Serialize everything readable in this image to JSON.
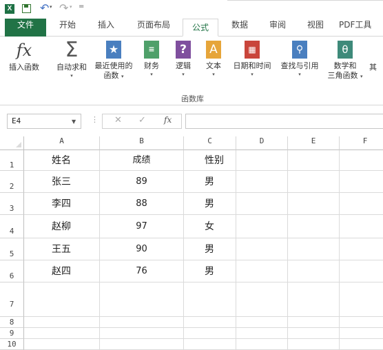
{
  "quick_access": {
    "app_logo_text": "X",
    "more_symbol": "="
  },
  "tabs": [
    {
      "label": "文件"
    },
    {
      "label": "开始"
    },
    {
      "label": "插入"
    },
    {
      "label": "页面布局"
    },
    {
      "label": "公式"
    },
    {
      "label": "数据"
    },
    {
      "label": "审阅"
    },
    {
      "label": "视图"
    },
    {
      "label": "PDF工具"
    }
  ],
  "ribbon": {
    "insert_function": "插入函数",
    "autosum": "自动求和",
    "recent_1": "最近使用的",
    "recent_2": "函数",
    "financial": "财务",
    "logical": "逻辑",
    "text": "文本",
    "datetime": "日期和时间",
    "lookup": "查找与引用",
    "math_1": "数学和",
    "math_2": "三角函数",
    "more_cut": "其",
    "group_label": "函数库",
    "fx_glyph": "fx",
    "sigma_glyph": "Σ",
    "logical_glyph": "?",
    "text_glyph": "A",
    "math_glyph": "θ"
  },
  "formula_bar": {
    "name_box": "E4",
    "fx_label": "fx",
    "formula": ""
  },
  "columns": [
    "A",
    "B",
    "C",
    "D",
    "E",
    "F"
  ],
  "rows": [
    {
      "num": "1",
      "a": "姓名",
      "b": "成绩",
      "c": "性别"
    },
    {
      "num": "2",
      "a": "张三",
      "b": "89",
      "c": "男"
    },
    {
      "num": "3",
      "a": "李四",
      "b": "88",
      "c": "男"
    },
    {
      "num": "4",
      "a": "赵柳",
      "b": "97",
      "c": "女"
    },
    {
      "num": "5",
      "a": "王五",
      "b": "90",
      "c": "男"
    },
    {
      "num": "6",
      "a": "赵四",
      "b": "76",
      "c": "男"
    },
    {
      "num": "7"
    },
    {
      "num": "8"
    },
    {
      "num": "9"
    },
    {
      "num": "10"
    }
  ],
  "colors": {
    "accent": "#217346",
    "ribbon_blue": "#4a7fbf",
    "ribbon_green": "#4fa06a",
    "ribbon_purple": "#7f4f9e",
    "ribbon_orange": "#e6a53a",
    "ribbon_red": "#c9453b",
    "ribbon_teal": "#3e8a7a"
  }
}
